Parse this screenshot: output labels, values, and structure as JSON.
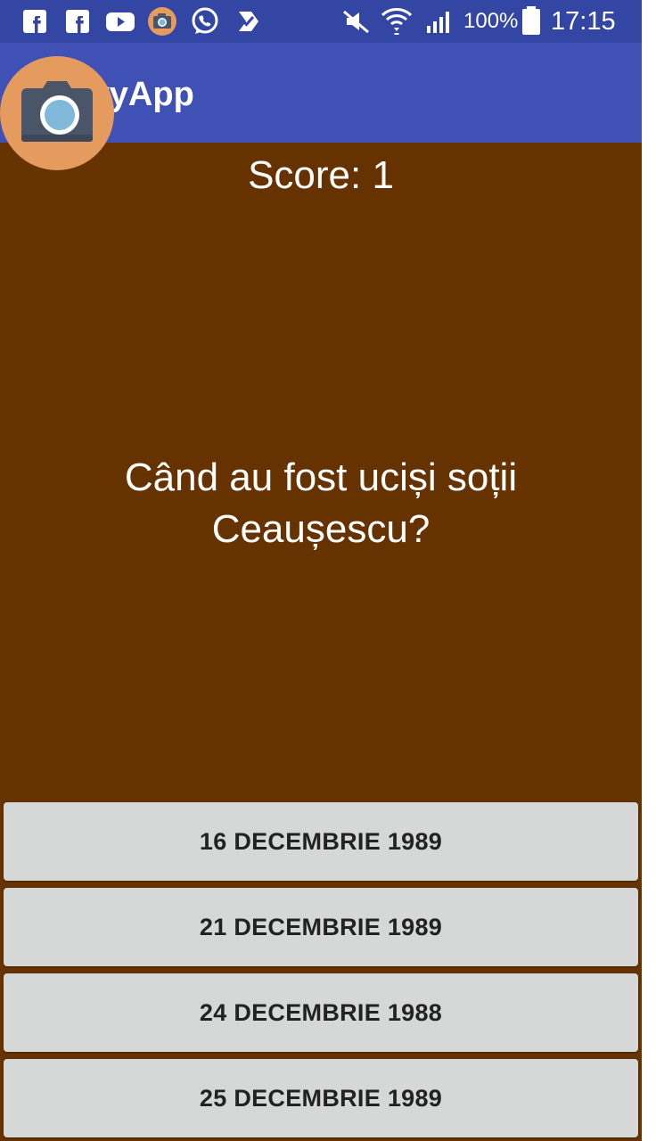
{
  "status_bar": {
    "icons": [
      "facebook-icon",
      "facebook-icon",
      "youtube-icon",
      "camera-app-icon",
      "whatsapp-icon",
      "check-icon",
      "mute-icon",
      "wifi-icon",
      "signal-icon",
      "battery-icon"
    ],
    "battery": "100%",
    "time": "17:15",
    "color": "#3446a3"
  },
  "app_bar": {
    "title": "ryApp",
    "color": "#3f51b5"
  },
  "floating_camera": {
    "icon": "camera-icon",
    "color": "#e59a5e"
  },
  "main": {
    "background": "#663300",
    "score": "Score: 1",
    "question": "Când au fost uciși soții Ceaușescu?"
  },
  "answers": [
    {
      "label": "16 decembrie 1989"
    },
    {
      "label": "21 decembrie 1989"
    },
    {
      "label": "24 decembrie 1988"
    },
    {
      "label": "25 decembrie 1989"
    }
  ]
}
